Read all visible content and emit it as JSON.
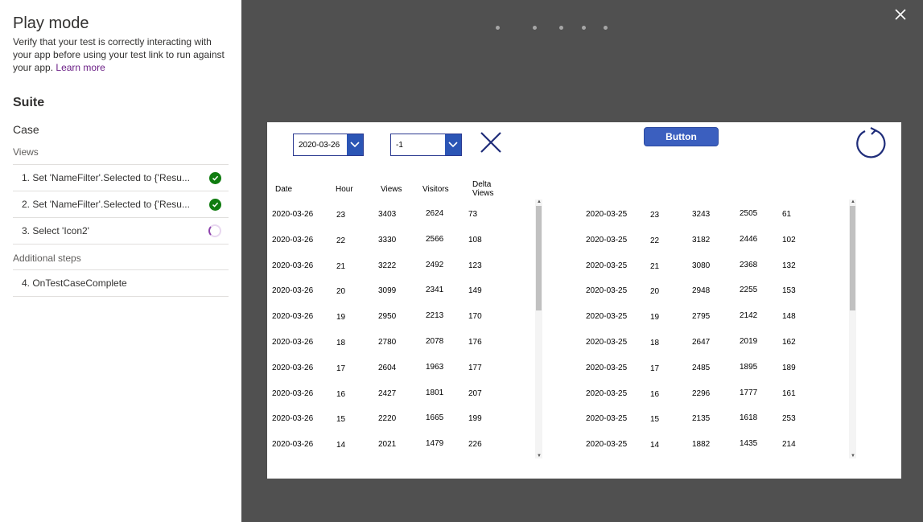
{
  "panel": {
    "title": "Play mode",
    "description": "Verify that your test is correctly interacting with your app before using your test link to run against your app.",
    "learn_more": "Learn more",
    "suite_label": "Suite",
    "case_label": "Case",
    "views_label": "Views",
    "steps": [
      {
        "label": "1. Set 'NameFilter'.Selected to {'Resu...",
        "status": "passed"
      },
      {
        "label": "2. Set 'NameFilter'.Selected to {'Resu...",
        "status": "passed"
      },
      {
        "label": "3. Select 'Icon2'",
        "status": "running"
      }
    ],
    "additional_label": "Additional steps",
    "additional_steps": [
      {
        "label": "4. OnTestCaseComplete"
      }
    ]
  },
  "app": {
    "date_dropdown": "2020-03-26",
    "filter_dropdown": "-1",
    "button_label": "Button",
    "headers": [
      "Date",
      "Hour",
      "Views",
      "Visitors",
      "Delta Views"
    ],
    "left_rows": [
      [
        "2020-03-26",
        "23",
        "3403",
        "2624",
        "73"
      ],
      [
        "2020-03-26",
        "22",
        "3330",
        "2566",
        "108"
      ],
      [
        "2020-03-26",
        "21",
        "3222",
        "2492",
        "123"
      ],
      [
        "2020-03-26",
        "20",
        "3099",
        "2341",
        "149"
      ],
      [
        "2020-03-26",
        "19",
        "2950",
        "2213",
        "170"
      ],
      [
        "2020-03-26",
        "18",
        "2780",
        "2078",
        "176"
      ],
      [
        "2020-03-26",
        "17",
        "2604",
        "1963",
        "177"
      ],
      [
        "2020-03-26",
        "16",
        "2427",
        "1801",
        "207"
      ],
      [
        "2020-03-26",
        "15",
        "2220",
        "1665",
        "199"
      ],
      [
        "2020-03-26",
        "14",
        "2021",
        "1479",
        "226"
      ]
    ],
    "right_rows": [
      [
        "2020-03-25",
        "23",
        "3243",
        "2505",
        "61"
      ],
      [
        "2020-03-25",
        "22",
        "3182",
        "2446",
        "102"
      ],
      [
        "2020-03-25",
        "21",
        "3080",
        "2368",
        "132"
      ],
      [
        "2020-03-25",
        "20",
        "2948",
        "2255",
        "153"
      ],
      [
        "2020-03-25",
        "19",
        "2795",
        "2142",
        "148"
      ],
      [
        "2020-03-25",
        "18",
        "2647",
        "2019",
        "162"
      ],
      [
        "2020-03-25",
        "17",
        "2485",
        "1895",
        "189"
      ],
      [
        "2020-03-25",
        "16",
        "2296",
        "1777",
        "161"
      ],
      [
        "2020-03-25",
        "15",
        "2135",
        "1618",
        "253"
      ],
      [
        "2020-03-25",
        "14",
        "1882",
        "1435",
        "214"
      ]
    ]
  },
  "colors": {
    "accent": "#2b55b5",
    "passed": "#107c10",
    "backdrop": "#505050"
  }
}
